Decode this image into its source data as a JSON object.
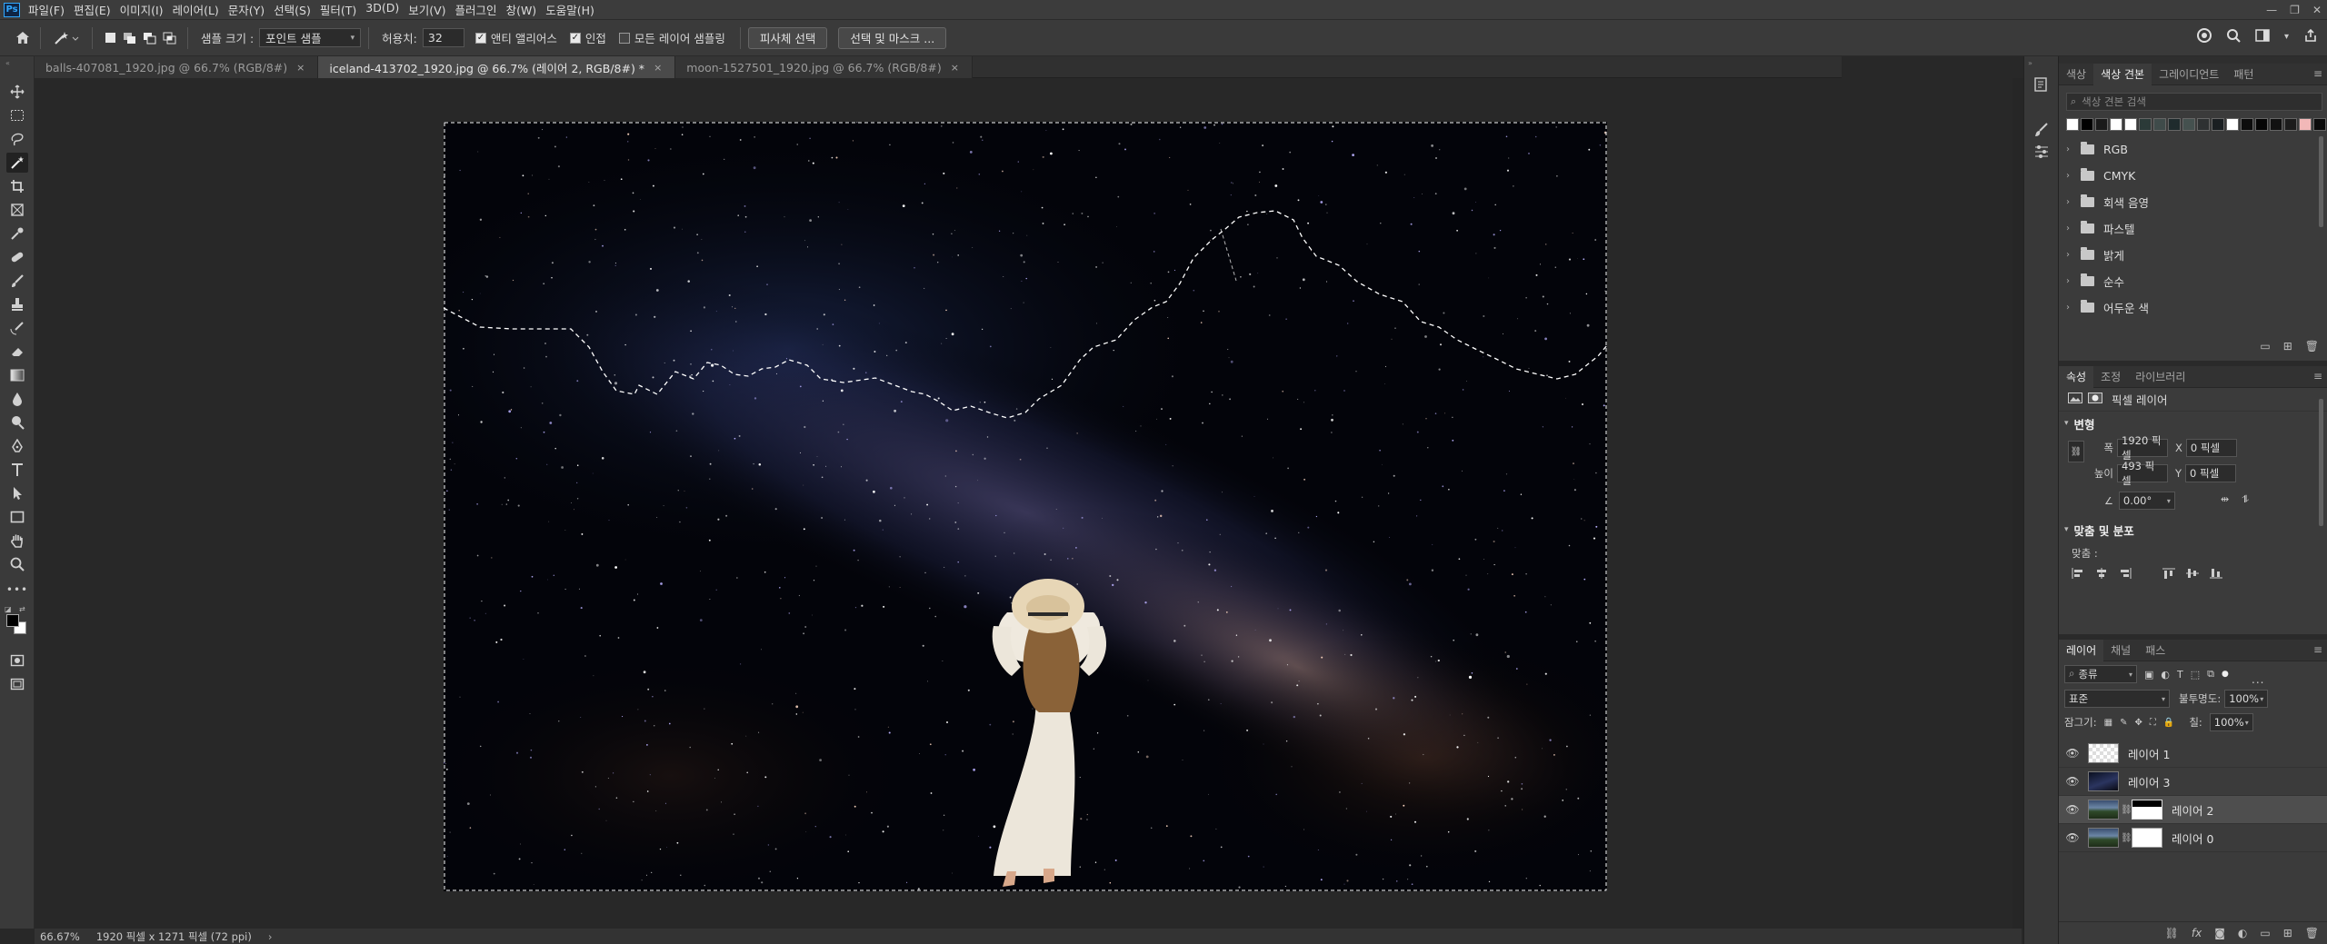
{
  "app": {
    "logo": "Ps"
  },
  "menu": [
    "파일(F)",
    "편집(E)",
    "이미지(I)",
    "레이어(L)",
    "문자(Y)",
    "선택(S)",
    "필터(T)",
    "3D(D)",
    "보기(V)",
    "플러그인",
    "창(W)",
    "도움말(H)"
  ],
  "options": {
    "sample_size_label": "샘플 크기 :",
    "sample_size_value": "포인트 샘플",
    "tolerance_label": "허용치:",
    "tolerance_value": "32",
    "antialias_label": "앤티 앨리어스",
    "antialias_checked": true,
    "contiguous_label": "인접",
    "contiguous_checked": true,
    "sample_all_label": "모든 레이어 샘플링",
    "sample_all_checked": false,
    "select_subject_btn": "피사체 선택",
    "select_mask_btn": "선택 및 마스크 ..."
  },
  "tabs": [
    {
      "label": "balls-407081_1920.jpg @ 66.7% (RGB/8#)",
      "active": false
    },
    {
      "label": "iceland-413702_1920.jpg @ 66.7% (레이어 2, RGB/8#) *",
      "active": true
    },
    {
      "label": "moon-1527501_1920.jpg @ 66.7% (RGB/8#)",
      "active": false
    }
  ],
  "status": {
    "zoom": "66.67%",
    "doc_info": "1920 픽셀 x 1271 픽셀 (72 ppi)"
  },
  "swatches_panel": {
    "tabs": [
      "색상",
      "색상 견본",
      "그레이디언트",
      "패턴"
    ],
    "active_tab": 1,
    "search_placeholder": "색상 견본 검색",
    "colors": [
      "#ffffff",
      "#000000",
      "#1a1a1a",
      "#ffffff",
      "#ffffff",
      "#2b3a38",
      "#3f4b4a",
      "#1f2b2d",
      "#45514f",
      "#2e3132",
      "#1a1f22",
      "#ffffff",
      "#0c0c0c",
      "#050505",
      "#111111",
      "#1c1c1c",
      "#f2b8b8",
      "#0a0a0a"
    ],
    "groups": [
      "RGB",
      "CMYK",
      "회색 음영",
      "파스텔",
      "밝게",
      "순수",
      "어두운 색"
    ]
  },
  "properties_panel": {
    "tabs": [
      "속성",
      "조정",
      "라이브러리"
    ],
    "active_tab": 0,
    "type_label": "픽셀 레이어",
    "transform_title": "변형",
    "width_label": "폭",
    "width_value": "1920 픽셀",
    "height_label": "높이",
    "height_value": "493 픽셀",
    "x_label": "X",
    "x_value": "0 픽셀",
    "y_label": "Y",
    "y_value": "0 픽셀",
    "angle_value": "0.00°",
    "align_title": "맞춤 및 분포",
    "align_label": "맞춤 :",
    "more": "..."
  },
  "layers_panel": {
    "tabs": [
      "레이어",
      "채널",
      "패스"
    ],
    "active_tab": 0,
    "filter_value": "종류",
    "blend_mode": "표준",
    "opacity_label": "불투명도:",
    "opacity_value": "100%",
    "lock_label": "잠그기:",
    "fill_label": "칠:",
    "fill_value": "100%",
    "layers": [
      {
        "name": "레이어 1",
        "thumb": "transparent",
        "mask": false,
        "visible": true,
        "selected": false
      },
      {
        "name": "레이어 3",
        "thumb": "sky",
        "mask": false,
        "visible": true,
        "selected": false
      },
      {
        "name": "레이어 2",
        "thumb": "landscape",
        "mask": "bw",
        "visible": true,
        "selected": true
      },
      {
        "name": "레이어 0",
        "thumb": "landscape",
        "mask": "white",
        "visible": true,
        "selected": false
      }
    ]
  }
}
